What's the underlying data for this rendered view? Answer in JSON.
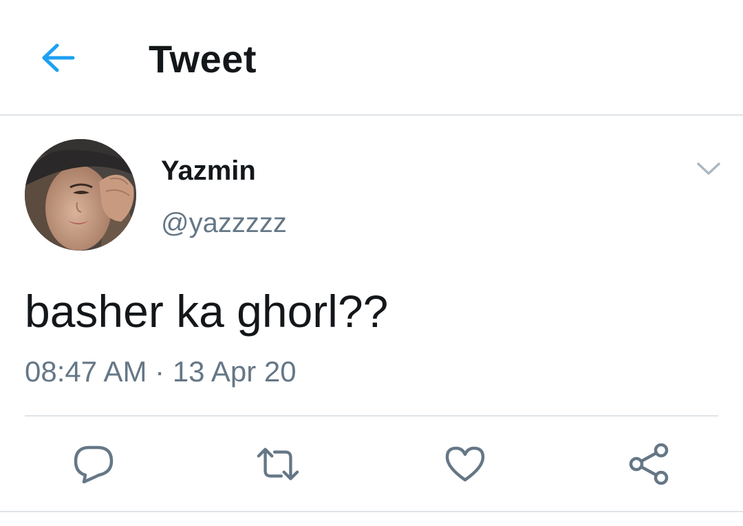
{
  "header": {
    "title": "Tweet",
    "back_icon": "arrow-left-icon"
  },
  "tweet": {
    "display_name": "Yazmin",
    "handle": "@yazzzzz",
    "text": "basher ka ghorl??",
    "time": "08:47 AM",
    "separator": "·",
    "date": "13 Apr 20",
    "caret_icon": "chevron-down-icon"
  },
  "actions": [
    {
      "name": "reply",
      "icon": "reply-icon"
    },
    {
      "name": "retweet",
      "icon": "retweet-icon"
    },
    {
      "name": "like",
      "icon": "heart-icon"
    },
    {
      "name": "share",
      "icon": "share-icon"
    }
  ],
  "colors": {
    "accent": "#1da1f2",
    "text_primary": "#14171a",
    "text_secondary": "#657786",
    "divider": "#dfe4e9"
  }
}
